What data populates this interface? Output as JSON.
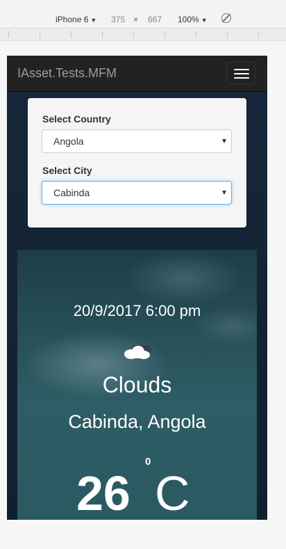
{
  "devtools": {
    "device": "iPhone 6",
    "width": "375",
    "times": "×",
    "height": "667",
    "zoom": "100%",
    "rotate_icon": "rotate-icon"
  },
  "app": {
    "brand": "IAsset.Tests.MFM",
    "menu_icon": "hamburger-icon"
  },
  "form": {
    "country_label": "Select Country",
    "country_value": "Angola",
    "city_label": "Select City",
    "city_value": "Cabinda"
  },
  "weather": {
    "datetime": "20/9/2017 6:00 pm",
    "icon": "cloud-icon",
    "condition": "Clouds",
    "location": "Cabinda, Angola",
    "temperature": "26",
    "degree": "0",
    "unit": "C"
  },
  "colors": {
    "navbar": "#222222",
    "brand_text": "#9d9d9d",
    "page_bg": "#152236",
    "focus_border": "#66afe9"
  }
}
